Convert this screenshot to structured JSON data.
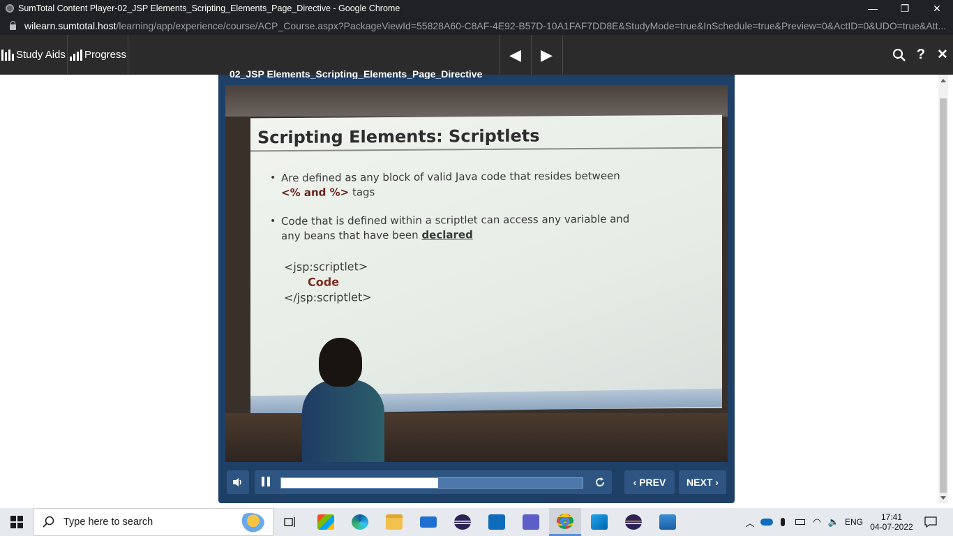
{
  "browser": {
    "window_title": "SumTotal Content Player-02_JSP Elements_Scripting_Elements_Page_Directive - Google Chrome",
    "url_host": "wilearn.sumtotal.host",
    "url_path": "/learning/app/experience/course/ACP_Course.aspx?PackageViewId=55828A60-C8AF-4E92-B57D-10A1FAF7DD8E&StudyMode=true&InSchedule=true&Preview=0&ActID=0&UDO=true&Att...",
    "controls": {
      "minimize": "—",
      "restore": "❐",
      "close": "✕"
    }
  },
  "lms_toolbar": {
    "study_aids_label": "Study Aids",
    "progress_label": "Progress",
    "prev_glyph": "◀",
    "next_glyph": "▶",
    "search_glyph": "⚲",
    "help_glyph": "?",
    "close_glyph": "✕"
  },
  "player": {
    "title": "02_JSP Elements_Scripting_Elements_Page_Directive",
    "slide": {
      "title": "Scripting Elements: Scriptlets",
      "bullet1_line1": "Are defined as any block of valid Java  code that resides between",
      "bullet1_line2_code": "<% and %>",
      "bullet1_line2_rest": " tags",
      "bullet2_line1": "Code that is defined within a scriptlet can access any variable and",
      "bullet2_line2_pre": "any beans that have been ",
      "bullet2_line2_emph": "declared",
      "code_open": "<jsp:scriptlet>",
      "code_body": "Code",
      "code_close": "</jsp:scriptlet>"
    },
    "controls": {
      "volume_glyph": "🔈",
      "pause_glyph": "❚❚",
      "replay_glyph": "↻",
      "prev_label": "‹ PREV",
      "next_label": "NEXT ›",
      "progress_fraction": 0.52
    }
  },
  "taskbar": {
    "search_placeholder": "Type here to search",
    "language": "ENG",
    "time": "17:41",
    "date": "04-07-2022"
  },
  "colors": {
    "lms_bar": "#2b2b2b",
    "player_frame": "#1e3f66",
    "control_button": "#2e5582"
  }
}
